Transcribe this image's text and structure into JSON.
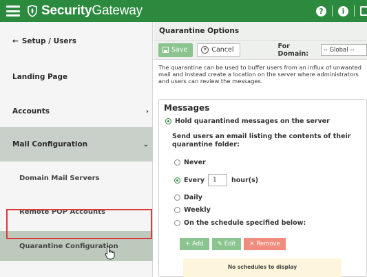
{
  "app": {
    "brand_bold": "Security",
    "brand_light": "Gateway"
  },
  "topbar": {
    "help_icon": "?",
    "info_icon": "i"
  },
  "sidebar": {
    "back_label": "Setup / Users",
    "items": [
      {
        "label": "Landing Page"
      },
      {
        "label": "Accounts",
        "chevron": "›"
      },
      {
        "label": "Mail Configuration",
        "chevron": "⌄"
      },
      {
        "label": "Domain Mail Servers"
      },
      {
        "label": "Remote POP Accounts"
      },
      {
        "label": "Quarantine Configuration"
      }
    ]
  },
  "main": {
    "title": "Quarantine Options",
    "toolbar": {
      "save_label": "Save",
      "cancel_label": "Cancel",
      "domain_label": "For Domain:",
      "domain_value": "-- Global --"
    },
    "description": "The quarantine can be used to buffer users from an influx of unwanted mail and instead create a location on the server where administrators and users can review the messages.",
    "messages": {
      "title": "Messages",
      "hold_label": "Hold quarantined messages on the server",
      "send_label": "Send users an email listing the contents of their quarantine folder:",
      "never_label": "Never",
      "every_label": "Every",
      "every_value": "1",
      "hours_label": "hour(s)",
      "daily_label": "Daily",
      "weekly_label": "Weekly",
      "schedule_label": "On the schedule specified below:",
      "add_label": "Add",
      "edit_label": "Edit",
      "remove_label": "Remove",
      "empty_label": "No schedules to display"
    }
  },
  "colors": {
    "brand_green": "#2b8a3e",
    "highlight_red": "#d93a3a"
  }
}
